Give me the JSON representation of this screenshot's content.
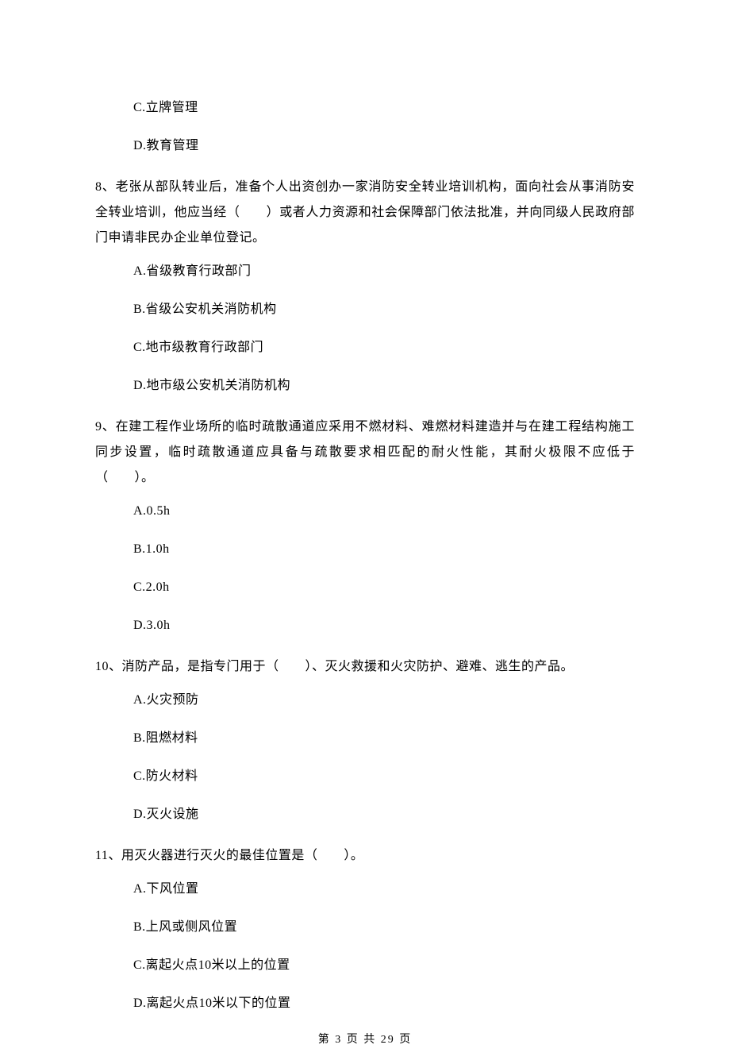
{
  "orphan_options": [
    "C.立牌管理",
    "D.教育管理"
  ],
  "questions": [
    {
      "text": "8、老张从部队转业后，准备个人出资创办一家消防安全转业培训机构，面向社会从事消防安全转业培训，他应当经（　　）或者人力资源和社会保障部门依法批准，并向同级人民政府部门申请非民办企业单位登记。",
      "options": [
        "A.省级教育行政部门",
        "B.省级公安机关消防机构",
        "C.地市级教育行政部门",
        "D.地市级公安机关消防机构"
      ]
    },
    {
      "text": "9、在建工程作业场所的临时疏散通道应采用不燃材料、难燃材料建造并与在建工程结构施工同步设置，临时疏散通道应具备与疏散要求相匹配的耐火性能，其耐火极限不应低于（　　）。",
      "options": [
        "A.0.5h",
        "B.1.0h",
        "C.2.0h",
        "D.3.0h"
      ]
    },
    {
      "text": "10、消防产品，是指专门用于（　　）、灭火救援和火灾防护、避难、逃生的产品。",
      "options": [
        "A.火灾预防",
        "B.阻燃材料",
        "C.防火材料",
        "D.灭火设施"
      ]
    },
    {
      "text": "11、用灭火器进行灭火的最佳位置是（　　）。",
      "options": [
        "A.下风位置",
        "B.上风或侧风位置",
        "C.离起火点10米以上的位置",
        "D.离起火点10米以下的位置"
      ]
    }
  ],
  "footer": "第 3 页 共 29 页"
}
